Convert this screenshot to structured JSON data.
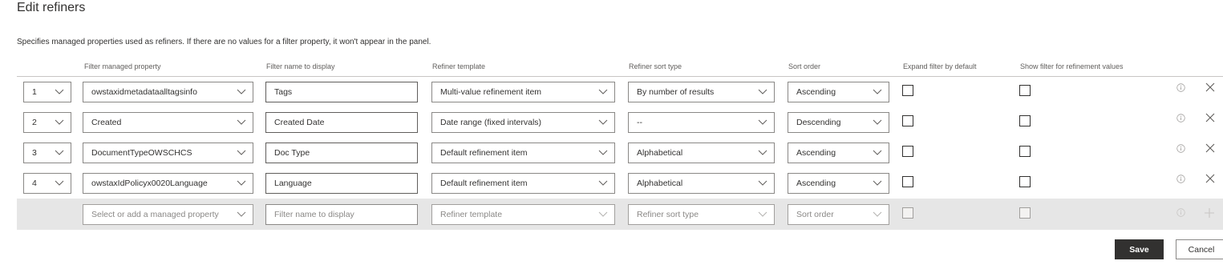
{
  "page": {
    "title": "Edit refiners",
    "description": "Specifies managed properties used as refiners. If there are no values for a filter property, it won't appear in the panel."
  },
  "columns": {
    "property": "Filter managed property",
    "name": "Filter name to display",
    "template": "Refiner template",
    "sort_type": "Refiner sort type",
    "sort_order": "Sort order",
    "expand": "Expand filter by default",
    "show_filter": "Show filter for refinement values"
  },
  "rows": [
    {
      "order": "1",
      "property": "owstaxidmetadataalltagsinfo",
      "name": "Tags",
      "template": "Multi-value refinement item",
      "sort_type": "By number of results",
      "sort_order": "Ascending",
      "expand": false,
      "show_filter": false
    },
    {
      "order": "2",
      "property": "Created",
      "name": "Created Date",
      "template": "Date range (fixed intervals)",
      "sort_type": "--",
      "sort_order": "Descending",
      "expand": false,
      "show_filter": false
    },
    {
      "order": "3",
      "property": "DocumentTypeOWSCHCS",
      "name": "Doc Type",
      "template": "Default refinement item",
      "sort_type": "Alphabetical",
      "sort_order": "Ascending",
      "expand": false,
      "show_filter": false
    },
    {
      "order": "4",
      "property": "owstaxIdPolicyx0020Language",
      "name": "Language",
      "template": "Default refinement item",
      "sort_type": "Alphabetical",
      "sort_order": "Ascending",
      "expand": false,
      "show_filter": false
    }
  ],
  "new_row": {
    "property_placeholder": "Select or add a managed property",
    "name_placeholder": "Filter name to display",
    "template_placeholder": "Refiner template",
    "sort_type_placeholder": "Refiner sort type",
    "sort_order_placeholder": "Sort order"
  },
  "actions": {
    "save": "Save",
    "cancel": "Cancel"
  },
  "icons": {
    "dropdown": "chevron-down-icon",
    "info": "info-icon",
    "remove": "close-icon",
    "add": "plus-icon"
  },
  "colors": {
    "primary_button": "#323130",
    "add_row_background": "#e6e6e6",
    "border": "#8a8886"
  }
}
